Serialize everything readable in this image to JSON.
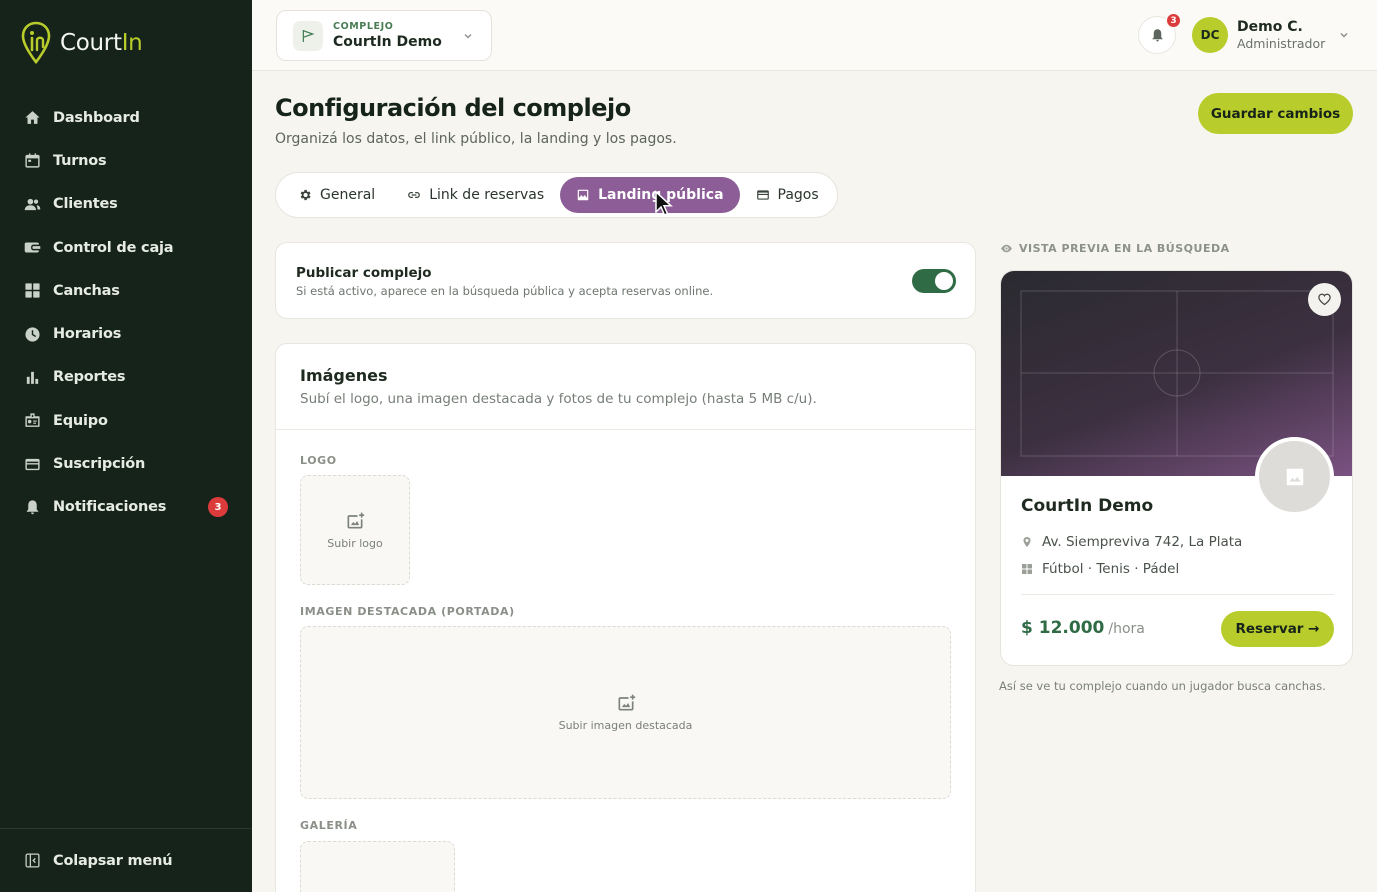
{
  "brand": {
    "name_main": "Court",
    "name_accent": "In"
  },
  "sidebar": {
    "items": [
      {
        "label": "Dashboard"
      },
      {
        "label": "Turnos"
      },
      {
        "label": "Clientes"
      },
      {
        "label": "Control de caja"
      },
      {
        "label": "Canchas"
      },
      {
        "label": "Horarios"
      },
      {
        "label": "Reportes"
      },
      {
        "label": "Equipo"
      },
      {
        "label": "Suscripción"
      },
      {
        "label": "Notificaciones",
        "badge": "3"
      }
    ],
    "collapse_label": "Colapsar menú"
  },
  "header": {
    "complex_kicker": "COMPLEJO",
    "complex_name": "CourtIn Demo",
    "bell_badge": "3",
    "user_initials": "DC",
    "user_name": "Demo C.",
    "user_role": "Administrador"
  },
  "page": {
    "title": "Configuración del complejo",
    "subtitle": "Organizá los datos, el link público, la landing y los pagos.",
    "save_label": "Guardar cambios"
  },
  "tabs": [
    {
      "label": "General",
      "active": false
    },
    {
      "label": "Link de reservas",
      "active": false
    },
    {
      "label": "Landing pública",
      "active": true
    },
    {
      "label": "Pagos",
      "active": false
    }
  ],
  "publish": {
    "title": "Publicar complejo",
    "description": "Si está activo, aparece en la búsqueda pública y acepta reservas online.",
    "enabled": true
  },
  "images": {
    "title": "Imágenes",
    "description": "Subí el logo, una imagen destacada y fotos de tu complejo (hasta 5 MB c/u).",
    "logo_label": "LOGO",
    "logo_upload": "Subir logo",
    "cover_label": "IMAGEN DESTACADA (PORTADA)",
    "cover_upload": "Subir imagen destacada",
    "gallery_label": "GALERÍA"
  },
  "preview": {
    "label": "VISTA PREVIA EN LA BÚSQUEDA",
    "name": "CourtIn Demo",
    "address": "Av. Siempreviva 742, La Plata",
    "sports": "Fútbol · Tenis · Pádel",
    "price": "$ 12.000",
    "price_unit": "/hora",
    "reserve_label": "Reservar →",
    "caption": "Así se ve tu complejo cuando un jugador busca canchas."
  },
  "colors": {
    "sidebar_bg": "#16231a",
    "accent_lime": "#b8cc2b",
    "active_tab": "#8d5d97",
    "toggle_on": "#2f6b45",
    "badge_red": "#dc3b3b"
  }
}
